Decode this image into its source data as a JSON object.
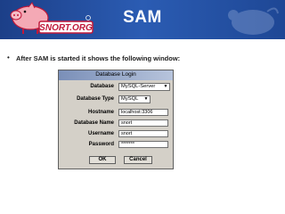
{
  "header": {
    "title": "SAM",
    "logo_text": "SNORT.ORG"
  },
  "bullet": {
    "text": "After SAM is started it shows the following window:"
  },
  "dialog": {
    "title": "Database Login",
    "database_label": "Database",
    "database_value": "MySQL-Server",
    "dbtype_label": "Database Type",
    "dbtype_value": "MySQL",
    "hostname_label": "Hostname",
    "hostname_value": "localhost:3306",
    "dbname_label": "Database Name",
    "dbname_value": "snort",
    "username_label": "Username",
    "username_value": "snort",
    "password_label": "Password",
    "password_value": "*******",
    "ok_label": "OK",
    "cancel_label": "Cancel"
  },
  "icons": {
    "logo": "snort-pig-logo",
    "dropdown": "chevron-down-icon"
  },
  "colors": {
    "banner": "#2b5cb3",
    "logo_text": "#c0183a"
  }
}
